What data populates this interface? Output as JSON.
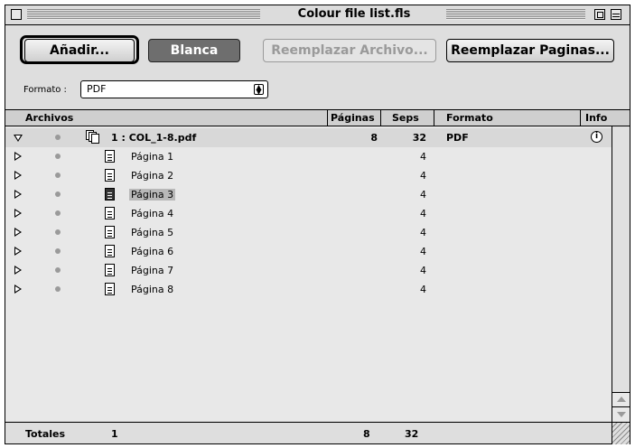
{
  "window": {
    "title": "Colour file list.fls"
  },
  "toolbar": {
    "add_label": "Añadir...",
    "blank_label": "Blanca",
    "replace_file_label": "Reemplazar Archivo...",
    "replace_pages_label": "Reemplazar Paginas..."
  },
  "format": {
    "label": "Formato :",
    "value": "PDF"
  },
  "table": {
    "headers": {
      "files": "Archivos",
      "pages": "Páginas",
      "seps": "Seps",
      "format": "Formato",
      "info": "Info"
    },
    "file": {
      "name": "1 : COL_1-8.pdf",
      "pages": "8",
      "seps": "32",
      "format": "PDF",
      "info_icon": "i"
    },
    "rows": [
      {
        "name": "Página 1",
        "seps": "4",
        "selected": false
      },
      {
        "name": "Página 2",
        "seps": "4",
        "selected": false
      },
      {
        "name": "Página 3",
        "seps": "4",
        "selected": true
      },
      {
        "name": "Página 4",
        "seps": "4",
        "selected": false
      },
      {
        "name": "Página 5",
        "seps": "4",
        "selected": false
      },
      {
        "name": "Página 6",
        "seps": "4",
        "selected": false
      },
      {
        "name": "Página 7",
        "seps": "4",
        "selected": false
      },
      {
        "name": "Página 8",
        "seps": "4",
        "selected": false
      }
    ]
  },
  "totals": {
    "label": "Totales",
    "files": "1",
    "pages": "8",
    "seps": "32"
  }
}
